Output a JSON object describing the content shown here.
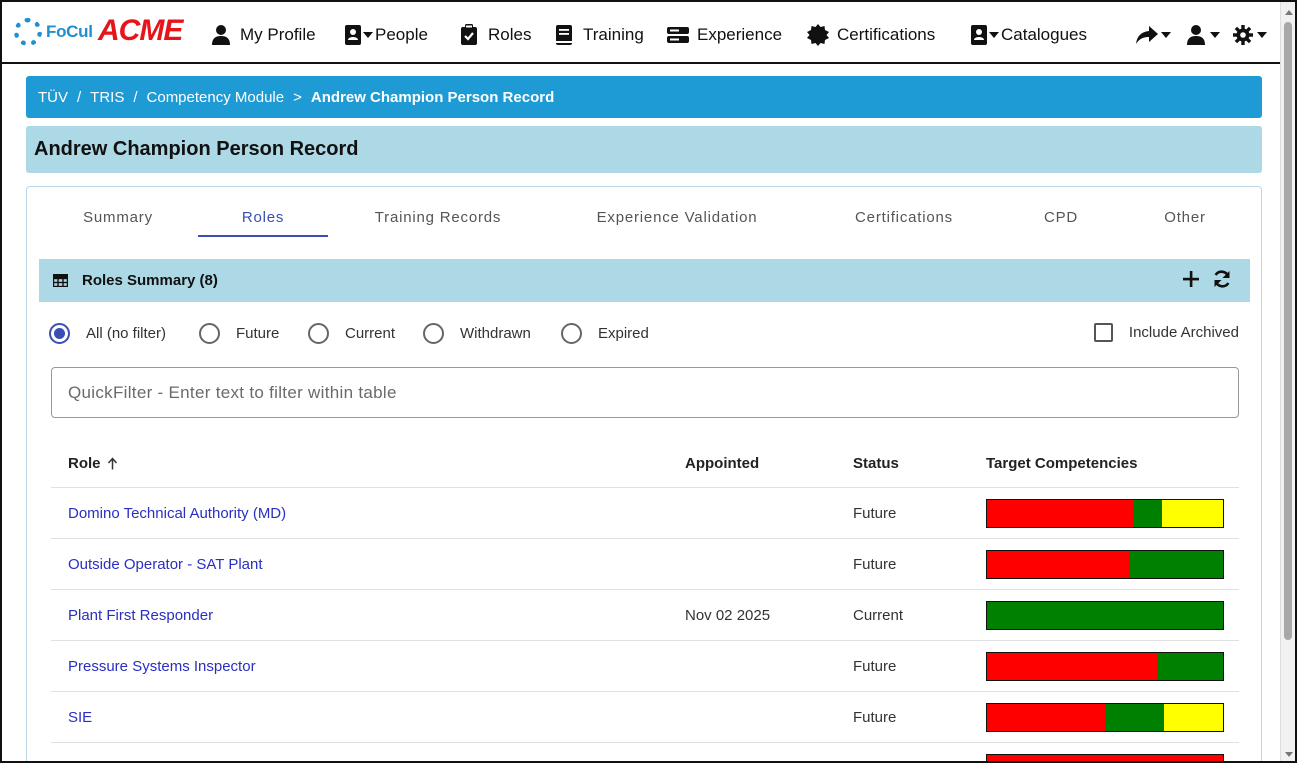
{
  "brand": {
    "logo_text": "FoCul",
    "acme_text": "ACME"
  },
  "nav": {
    "my_profile": "My Profile",
    "people": "People",
    "roles": "Roles",
    "training": "Training",
    "experience": "Experience",
    "certifications": "Certifications",
    "catalogues": "Catalogues"
  },
  "breadcrumb": {
    "items": [
      "TÜV",
      "TRIS",
      "Competency Module"
    ],
    "separators": [
      "/",
      "/",
      ">"
    ],
    "current": "Andrew Champion Person Record"
  },
  "page": {
    "title": "Andrew Champion Person Record"
  },
  "tabs": [
    "Summary",
    "Roles",
    "Training Records",
    "Experience Validation",
    "Certifications",
    "CPD",
    "Other"
  ],
  "active_tab": "Roles",
  "panel": {
    "title": "Roles Summary (8)"
  },
  "filters": {
    "options": [
      "All (no filter)",
      "Future",
      "Current",
      "Withdrawn",
      "Expired"
    ],
    "selected": "All (no filter)",
    "include_archived_label": "Include Archived",
    "include_archived": false
  },
  "quickfilter": {
    "placeholder": "QuickFilter - Enter text to filter within table",
    "value": ""
  },
  "table": {
    "columns": [
      "Role",
      "Appointed",
      "Status",
      "Target Competencies"
    ],
    "sort": {
      "column": "Role",
      "direction": "asc"
    },
    "rows": [
      {
        "role": "Domino Technical Authority (MD)",
        "appointed": "",
        "status": "Future",
        "competencies": [
          {
            "color": "#ff0000",
            "fraction": 0.62
          },
          {
            "color": "#008000",
            "fraction": 0.12
          },
          {
            "color": "#ffff00",
            "fraction": 0.26
          }
        ]
      },
      {
        "role": "Outside Operator - SAT Plant",
        "appointed": "",
        "status": "Future",
        "competencies": [
          {
            "color": "#ff0000",
            "fraction": 0.6
          },
          {
            "color": "#008000",
            "fraction": 0.4
          }
        ]
      },
      {
        "role": "Plant First Responder",
        "appointed": "Nov 02 2025",
        "status": "Current",
        "competencies": [
          {
            "color": "#008000",
            "fraction": 1.0
          }
        ]
      },
      {
        "role": "Pressure Systems Inspector",
        "appointed": "",
        "status": "Future",
        "competencies": [
          {
            "color": "#ff0000",
            "fraction": 0.72
          },
          {
            "color": "#008000",
            "fraction": 0.28
          }
        ]
      },
      {
        "role": "SIE",
        "appointed": "",
        "status": "Future",
        "competencies": [
          {
            "color": "#ff0000",
            "fraction": 0.5
          },
          {
            "color": "#008000",
            "fraction": 0.25
          },
          {
            "color": "#ffff00",
            "fraction": 0.25
          }
        ]
      },
      {
        "role": "",
        "appointed": "",
        "status": "",
        "competencies": [
          {
            "color": "#ff0000",
            "fraction": 1.0
          }
        ]
      }
    ]
  },
  "colors": {
    "accent": "#3a4fb3",
    "breadcrumb_bg": "#1e9bd4",
    "header_bg": "#add8e6",
    "link": "#2a2fc0"
  }
}
